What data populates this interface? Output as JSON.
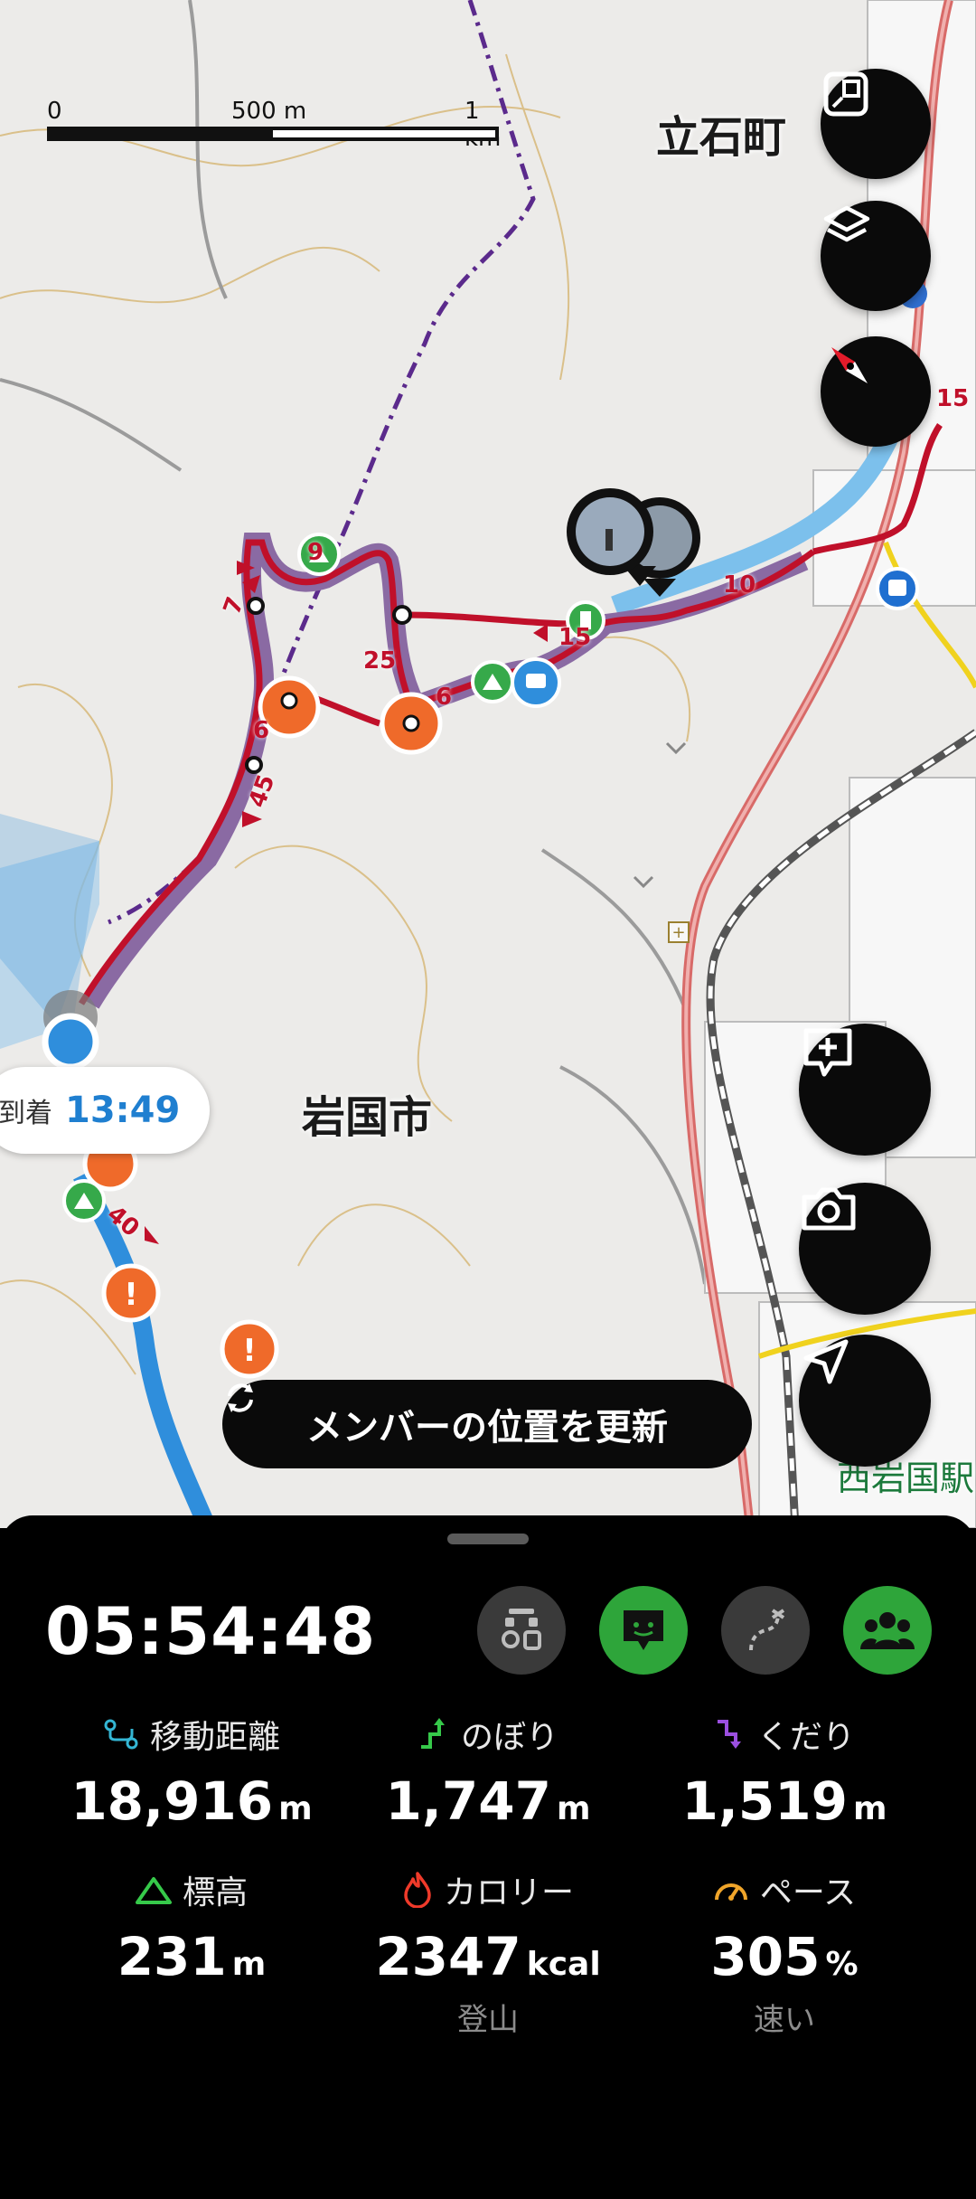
{
  "map": {
    "scale": {
      "zero": "0",
      "mid": "500 m",
      "end": "1 km"
    },
    "places": {
      "tateishi": "立石町",
      "iwakuni": "岩国市",
      "station": "西岩国駅"
    },
    "route_labels": {
      "a": "9",
      "b": "7",
      "c": "25",
      "d": "6",
      "e": "6",
      "f": "45",
      "g": "15",
      "h": "10",
      "i": "15",
      "j": "40"
    },
    "arrival": {
      "label": "到着",
      "time": "13:49"
    },
    "refresh_label": "メンバーの位置を更新",
    "colors": {
      "route": "#c0102a",
      "route_track": "#8a6aa3",
      "water": "#7cc0ec",
      "accent_green": "#36c94a",
      "hazard": "#ef6a2a"
    }
  },
  "controls": {
    "map_fit": "map-fit-icon",
    "layers": "layers-icon",
    "compass": "compass-icon",
    "add_note": "add-note-icon",
    "camera": "camera-icon",
    "locate": "locate-icon"
  },
  "panel": {
    "elapsed": "05:54:48",
    "stats": {
      "distance": {
        "label": "移動距離",
        "value": "18,916",
        "unit": "m"
      },
      "ascent": {
        "label": "のぼり",
        "value": "1,747",
        "unit": "m"
      },
      "descent": {
        "label": "くだり",
        "value": "1,519",
        "unit": "m"
      },
      "altitude": {
        "label": "標高",
        "value": "231",
        "unit": "m"
      },
      "calories": {
        "label": "カロリー",
        "value": "2347",
        "unit": "kcal",
        "sub": "登山"
      },
      "pace": {
        "label": "ペース",
        "value": "305",
        "unit": "%",
        "sub": "速い"
      }
    }
  }
}
